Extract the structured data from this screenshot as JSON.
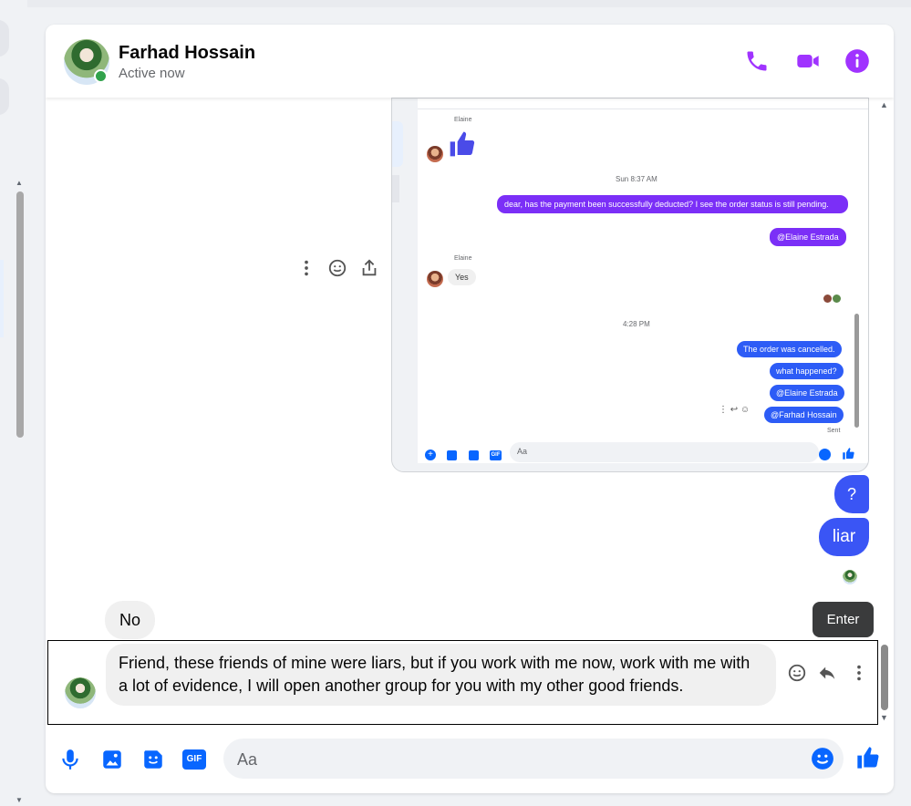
{
  "contact": {
    "name": "Farhad Hossain",
    "status": "Active now"
  },
  "colors": {
    "accent": "#a033ff",
    "bubble_me": "#3a55f5",
    "bubble_them": "#f0f0f0",
    "messenger_blue": "#0866ff"
  },
  "header_icons": [
    "phone-icon",
    "video-call-icon",
    "info-icon"
  ],
  "embedded_screenshot": {
    "sender_label_1": "Elaine",
    "timestamp_1": "Sun 8:37 AM",
    "msg_payment": "dear, has the payment been successfully deducted? I see the order status is still pending.",
    "mention_elaine_1": "@Elaine Estrada",
    "sender_label_2": "Elaine",
    "reply_yes": "Yes",
    "timestamp_2": "4:28 PM",
    "msg_cancelled": "The order was cancelled.",
    "msg_what": "what happened?",
    "mention_elaine_2": "@Elaine Estrada",
    "mention_farhad": "@Farhad Hossain",
    "sent_label": "Sent",
    "input_placeholder": "Aa"
  },
  "messages": {
    "q": "?",
    "liar": "liar",
    "no": "No",
    "friend": "Friend, these friends of mine were liars, but if you work with me now, work with me with a lot of evidence, I will open another group for you with my other good friends."
  },
  "tooltip": "Enter",
  "composer": {
    "placeholder": "Aa"
  }
}
